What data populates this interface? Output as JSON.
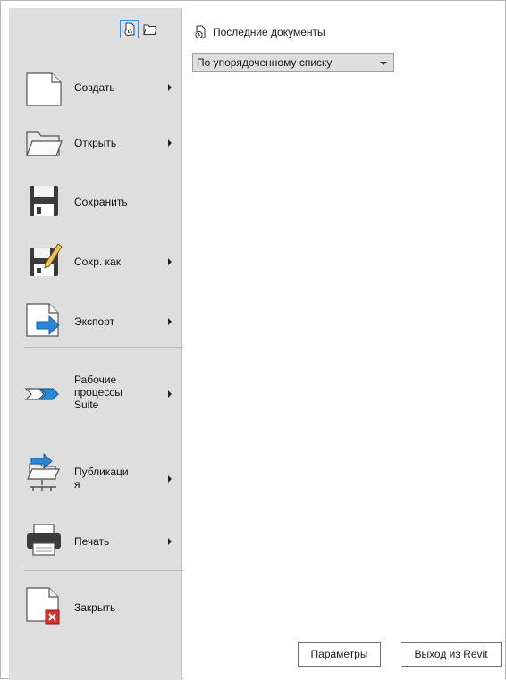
{
  "toolbar": {
    "recent_docs_icon": "recent-documents-icon",
    "open_docs_icon": "open-documents-icon"
  },
  "menu": {
    "items": [
      {
        "label": "Создать",
        "icon": "new-document-icon",
        "submenu": true
      },
      {
        "label": "Открыть",
        "icon": "open-folder-icon",
        "submenu": true
      },
      {
        "label": "Сохранить",
        "icon": "save-icon",
        "submenu": false
      },
      {
        "label": "Сохр. как",
        "icon": "save-as-icon",
        "submenu": true
      },
      {
        "label": "Экспорт",
        "icon": "export-icon",
        "submenu": true
      },
      {
        "label": "Рабочие\nпроцессы\nSuite",
        "icon": "suite-workflows-icon",
        "submenu": true
      },
      {
        "label": "Публикаци\nя",
        "icon": "publish-icon",
        "submenu": true
      },
      {
        "label": "Печать",
        "icon": "print-icon",
        "submenu": true
      },
      {
        "label": "Закрыть",
        "icon": "close-document-icon",
        "submenu": false
      }
    ]
  },
  "recent": {
    "title": "Последние документы",
    "sort_value": "По упорядоченному списку"
  },
  "footer": {
    "options_label": "Параметры",
    "exit_label": "Выход из Revit"
  },
  "colors": {
    "panel_bg": "#dedede",
    "accent": "#3a8ed8",
    "close_red": "#d9302b"
  }
}
